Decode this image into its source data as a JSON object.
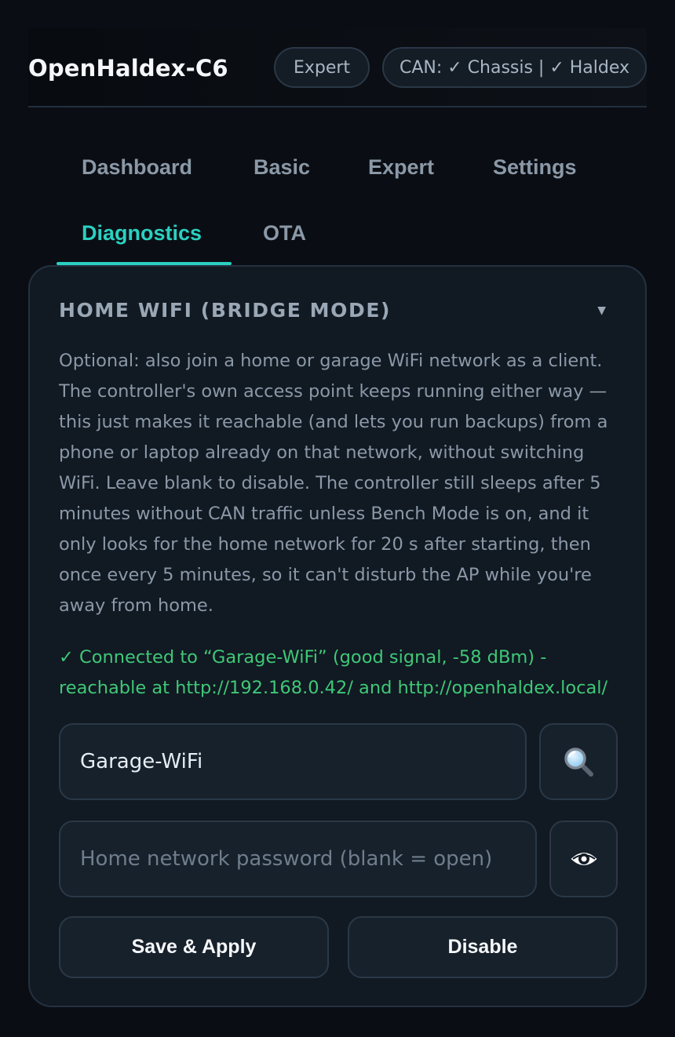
{
  "app": {
    "title": "OpenHaldex-C6",
    "mode_badge": "Expert",
    "can_status": "CAN: ✓ Chassis | ✓ Haldex"
  },
  "nav": {
    "tabs": [
      {
        "label": "Dashboard",
        "active": false
      },
      {
        "label": "Basic",
        "active": false
      },
      {
        "label": "Expert",
        "active": false
      },
      {
        "label": "Settings",
        "active": false
      },
      {
        "label": "Diagnostics",
        "active": true
      },
      {
        "label": "OTA",
        "active": false
      }
    ]
  },
  "card": {
    "title": "HOME WIFI (BRIDGE MODE)",
    "collapse_icon": "caret-down-icon",
    "description": "Optional: also join a home or garage WiFi network as a client. The controller's own access point keeps running either way — this just makes it reachable (and lets you run backups) from a phone or laptop already on that network, without switching WiFi. Leave blank to disable. The controller still sleeps after 5 minutes without CAN traffic unless Bench Mode is on, and it only looks for the home network for 20 s after starting, then once every 5 minutes, so it can't disturb the AP while you're away from home.",
    "status": "✓ Connected to “Garage-WiFi” (good signal, -58 dBm) - reachable at http://192.168.0.42/ and http://openhaldex.local/",
    "ssid_value": "Garage-WiFi",
    "ssid_placeholder": "",
    "scan_icon": "magnifier-icon",
    "password_value": "",
    "password_placeholder": "Home network password (blank = open)",
    "reveal_icon": "eye-icon",
    "save_label": "Save & Apply",
    "disable_label": "Disable"
  },
  "colors": {
    "background": "#0a0e14",
    "card": "#111923",
    "accent": "#2ad0c0",
    "success": "#3fc876",
    "muted_text": "#8b98a7"
  }
}
